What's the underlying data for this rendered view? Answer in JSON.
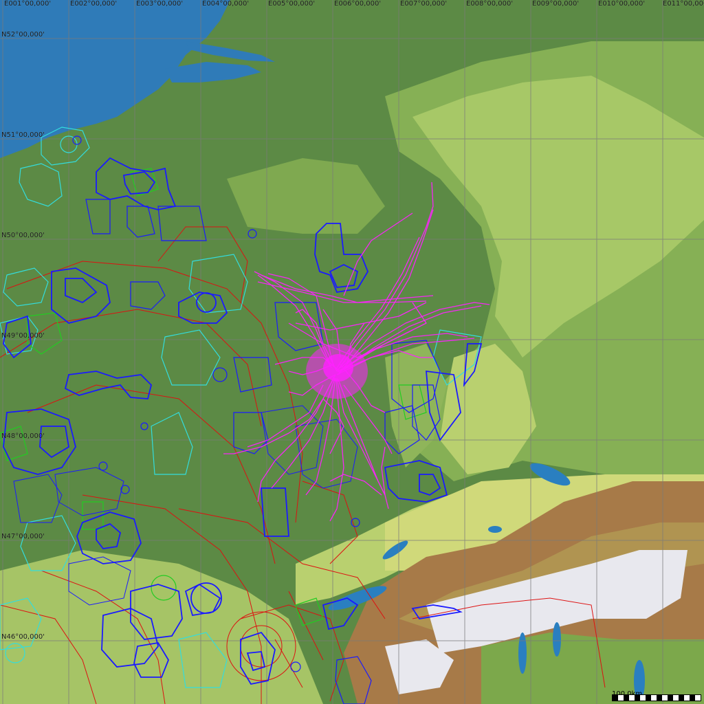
{
  "map": {
    "longitude_labels": [
      "E001°00,000'",
      "E002°00,000'",
      "E003°00,000'",
      "E004°00,000'",
      "E005°00,000'",
      "E006°00,000'",
      "E007°00,000'",
      "E008°00,000'",
      "E009°00,000'",
      "E010°00,000'",
      "E011°00,000'"
    ],
    "latitude_labels": [
      "N52°00,000'",
      "N51°00,000'",
      "N50°00,000'",
      "N49°00,000'",
      "N48°00,000'",
      "N47°00,000'",
      "N46°00,000'"
    ],
    "scale_label": "100,0km",
    "colors": {
      "sea": "#2f7bb8",
      "lowland": "#5c8a45",
      "hills": "#9fc063",
      "high_hills": "#d7df7a",
      "alps_rock": "#9a6b3e",
      "alps_snow": "#e8e8ee",
      "lakes": "#2a7fc0",
      "airspace_blue": "#1a1aff",
      "airspace_cyan": "#33dddd",
      "airspace_red": "#dd1111",
      "airspace_green": "#22cc22",
      "flight_tracks": "#ff22ff",
      "grid": "#7a7a7a"
    }
  }
}
